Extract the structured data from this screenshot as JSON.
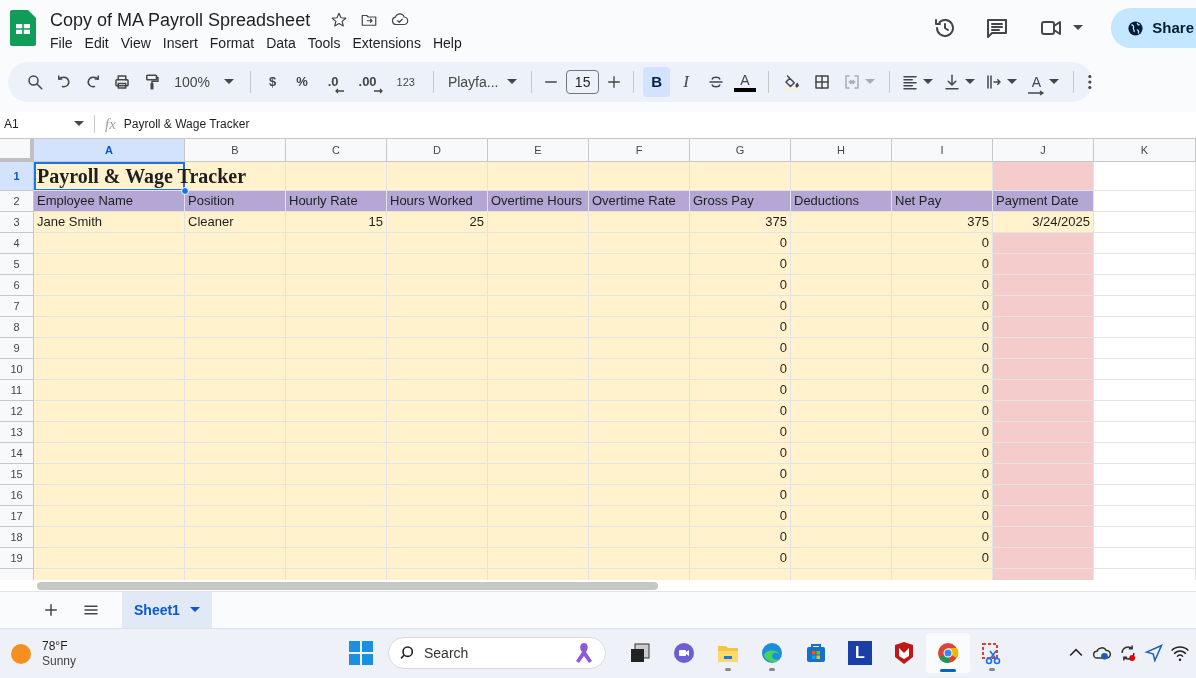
{
  "document": {
    "title": "Copy of MA Payroll Spreadsheet",
    "menus": [
      "File",
      "Edit",
      "View",
      "Insert",
      "Format",
      "Data",
      "Tools",
      "Extensions",
      "Help"
    ],
    "share_label": "Share"
  },
  "toolbar": {
    "history": [
      {
        "kind": "search"
      },
      {
        "kind": "undo"
      },
      {
        "kind": "redo"
      },
      {
        "kind": "print"
      },
      {
        "kind": "paint_format"
      }
    ],
    "zoom": "100%",
    "number_formats": [
      {
        "kind": "currency",
        "label": "$"
      },
      {
        "kind": "percent",
        "label": "%"
      },
      {
        "kind": "decrease_decimals",
        "label": ".0"
      },
      {
        "kind": "increase_decimals",
        "label": ".00"
      },
      {
        "kind": "more_formats",
        "label": "123"
      }
    ],
    "font": "Playfa...",
    "font_size": "15",
    "text_style": [
      {
        "kind": "bold",
        "label": "B",
        "on": true
      },
      {
        "kind": "italic",
        "label": "I",
        "on": false
      },
      {
        "kind": "strikethrough",
        "on": false
      }
    ],
    "text_color_label": "A",
    "cell_tools": [
      {
        "kind": "fill_color",
        "disabled": false
      },
      {
        "kind": "borders",
        "disabled": false
      },
      {
        "kind": "merge",
        "disabled": true
      }
    ],
    "align_tools": [
      {
        "kind": "horizontal_align"
      },
      {
        "kind": "vertical_align"
      },
      {
        "kind": "text_wrap"
      },
      {
        "kind": "text_rotation",
        "label": "A"
      }
    ]
  },
  "formula_bar": {
    "cell_ref": "A1",
    "fx": "fx",
    "content": "Payroll & Wage Tracker"
  },
  "columns": [
    {
      "label": "A",
      "selected": true,
      "numeric": false
    },
    {
      "label": "B",
      "selected": false,
      "numeric": false
    },
    {
      "label": "C",
      "selected": false,
      "numeric": true
    },
    {
      "label": "D",
      "selected": false,
      "numeric": true
    },
    {
      "label": "E",
      "selected": false
    },
    {
      "label": "F",
      "selected": false
    },
    {
      "label": "G",
      "selected": false,
      "numeric": true
    },
    {
      "label": "H",
      "selected": false
    },
    {
      "label": "I",
      "selected": false,
      "numeric": true
    },
    {
      "label": "J",
      "selected": false,
      "numeric": true
    },
    {
      "label": "K",
      "selected": false
    }
  ],
  "rows": [
    {
      "label": "1",
      "selected": true,
      "kind": "title",
      "color": "#f4cccc",
      "cells": [
        "Payroll & Wage Tracker",
        "",
        "",
        "",
        "",
        "",
        "",
        "",
        "",
        "",
        ""
      ]
    },
    {
      "label": "2",
      "selected": false,
      "kind": "header",
      "color": "#b4a7d6",
      "cells": [
        "Employee Name",
        "Position",
        "Hourly Rate",
        "Hours Worked",
        "Overtime Hours",
        "Overtime Rate",
        "Gross Pay",
        "Deductions",
        "Net Pay",
        "Payment Date",
        ""
      ]
    },
    {
      "label": "3",
      "selected": false,
      "kind": "data",
      "color": "#fff2cc",
      "cells": [
        "Jane Smith",
        "Cleaner",
        "15",
        "25",
        "",
        "",
        "375",
        "",
        "375",
        "3/24/2025",
        ""
      ]
    },
    {
      "label": "4",
      "selected": false,
      "kind": "data",
      "color": "#f4cccc",
      "cells": [
        "",
        "",
        "",
        "",
        "",
        "",
        "0",
        "",
        "0",
        "",
        ""
      ]
    },
    {
      "label": "5",
      "selected": false,
      "kind": "data",
      "color": "#f4cccc",
      "cells": [
        "",
        "",
        "",
        "",
        "",
        "",
        "0",
        "",
        "0",
        "",
        ""
      ]
    },
    {
      "label": "6",
      "selected": false,
      "kind": "data",
      "color": "#f4cccc",
      "cells": [
        "",
        "",
        "",
        "",
        "",
        "",
        "0",
        "",
        "0",
        "",
        ""
      ]
    },
    {
      "label": "7",
      "selected": false,
      "kind": "data",
      "color": "#f4cccc",
      "cells": [
        "",
        "",
        "",
        "",
        "",
        "",
        "0",
        "",
        "0",
        "",
        ""
      ]
    },
    {
      "label": "8",
      "selected": false,
      "kind": "data",
      "color": "#f4cccc",
      "cells": [
        "",
        "",
        "",
        "",
        "",
        "",
        "0",
        "",
        "0",
        "",
        ""
      ]
    },
    {
      "label": "9",
      "selected": false,
      "kind": "data",
      "color": "#f4cccc",
      "cells": [
        "",
        "",
        "",
        "",
        "",
        "",
        "0",
        "",
        "0",
        "",
        ""
      ]
    },
    {
      "label": "10",
      "selected": false,
      "kind": "data",
      "color": "#f4cccc",
      "cells": [
        "",
        "",
        "",
        "",
        "",
        "",
        "0",
        "",
        "0",
        "",
        ""
      ]
    },
    {
      "label": "11",
      "selected": false,
      "kind": "data",
      "color": "#f4cccc",
      "cells": [
        "",
        "",
        "",
        "",
        "",
        "",
        "0",
        "",
        "0",
        "",
        ""
      ]
    },
    {
      "label": "12",
      "selected": false,
      "kind": "data",
      "color": "#f4cccc",
      "cells": [
        "",
        "",
        "",
        "",
        "",
        "",
        "0",
        "",
        "0",
        "",
        ""
      ]
    },
    {
      "label": "13",
      "selected": false,
      "kind": "data",
      "color": "#f4cccc",
      "cells": [
        "",
        "",
        "",
        "",
        "",
        "",
        "0",
        "",
        "0",
        "",
        ""
      ]
    },
    {
      "label": "14",
      "selected": false,
      "kind": "data",
      "color": "#f4cccc",
      "cells": [
        "",
        "",
        "",
        "",
        "",
        "",
        "0",
        "",
        "0",
        "",
        ""
      ]
    },
    {
      "label": "15",
      "selected": false,
      "kind": "data",
      "color": "#f4cccc",
      "cells": [
        "",
        "",
        "",
        "",
        "",
        "",
        "0",
        "",
        "0",
        "",
        ""
      ]
    },
    {
      "label": "16",
      "selected": false,
      "kind": "data",
      "color": "#f4cccc",
      "cells": [
        "",
        "",
        "",
        "",
        "",
        "",
        "0",
        "",
        "0",
        "",
        ""
      ]
    },
    {
      "label": "17",
      "selected": false,
      "kind": "data",
      "color": "#f4cccc",
      "cells": [
        "",
        "",
        "",
        "",
        "",
        "",
        "0",
        "",
        "0",
        "",
        ""
      ]
    },
    {
      "label": "18",
      "selected": false,
      "kind": "data",
      "color": "#f4cccc",
      "cells": [
        "",
        "",
        "",
        "",
        "",
        "",
        "0",
        "",
        "0",
        "",
        ""
      ]
    },
    {
      "label": "19",
      "selected": false,
      "kind": "data",
      "color": "#f4cccc",
      "cells": [
        "",
        "",
        "",
        "",
        "",
        "",
        "0",
        "",
        "0",
        "",
        ""
      ]
    }
  ],
  "sheet_tabs": [
    {
      "label": "Sheet1",
      "selected": true
    }
  ],
  "taskbar": {
    "weather": {
      "temperature": "78°F",
      "condition": "Sunny"
    },
    "search_placeholder": "Search",
    "apps": [
      {
        "kind": "ribbon"
      },
      {
        "kind": "task_view"
      },
      {
        "kind": "meet"
      },
      {
        "kind": "folder"
      },
      {
        "kind": "edge"
      },
      {
        "kind": "store"
      },
      {
        "kind": "letter_app",
        "label": "L"
      },
      {
        "kind": "shield"
      },
      {
        "kind": "chrome"
      },
      {
        "kind": "snip"
      }
    ],
    "tray": [
      {
        "kind": "chevron"
      },
      {
        "kind": "cloud"
      },
      {
        "kind": "sync"
      },
      {
        "kind": "location"
      },
      {
        "kind": "wifi"
      }
    ]
  }
}
